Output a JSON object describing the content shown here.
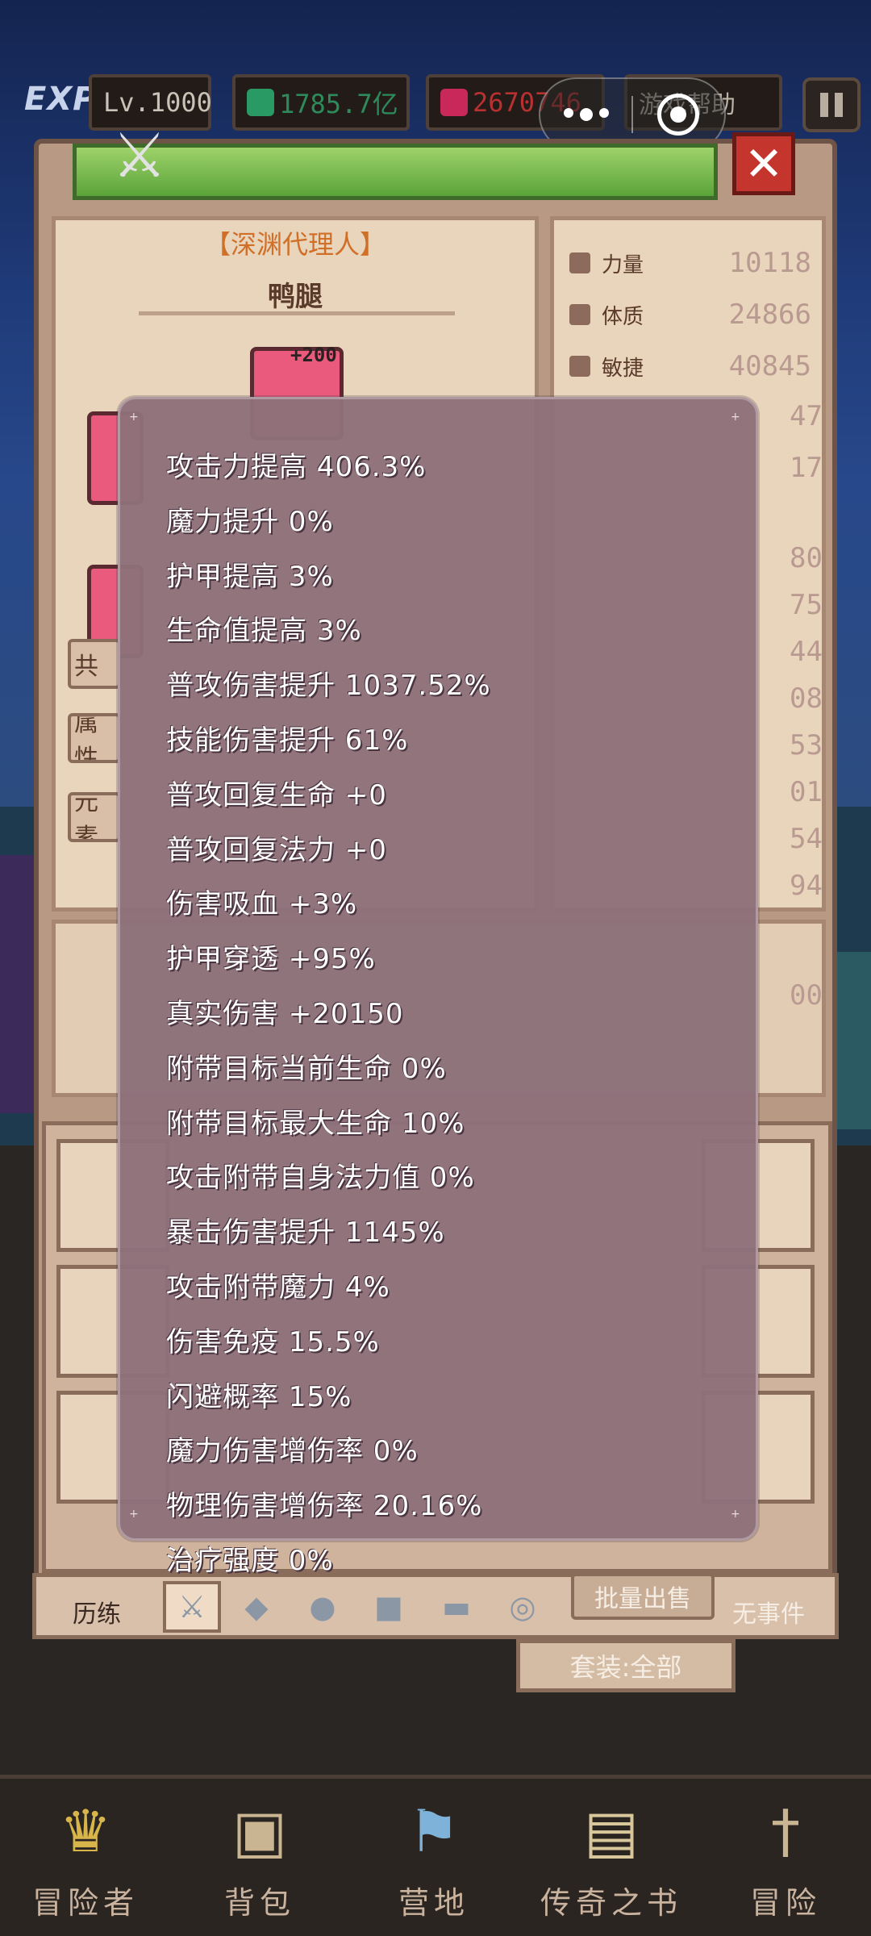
{
  "hud": {
    "exp_label": "EXP",
    "level": "Lv.1000",
    "currency_green": "1785.7亿",
    "currency_red": "2670746",
    "help": "游戏帮助"
  },
  "icons": {
    "close": "close-icon",
    "swords": "crossed-swords-icon",
    "menu_dots": "more-dots-icon",
    "target": "target-icon",
    "pause": "pause-icon"
  },
  "character": {
    "title": "【深渊代理人】",
    "name": "鸭腿",
    "slot_badge": "+200"
  },
  "stats": [
    {
      "label": "力量",
      "value": "10118"
    },
    {
      "label": "体质",
      "value": "24866"
    },
    {
      "label": "敏捷",
      "value": "40845"
    }
  ],
  "partial_values": [
    "47",
    "17",
    "80",
    "75",
    "44",
    "08",
    "53",
    "01",
    "54",
    "94",
    "00"
  ],
  "side_tabs": [
    "共",
    "属性",
    "元素"
  ],
  "tooltip": {
    "lines": [
      "攻击力提高 406.3%",
      "魔力提升 0%",
      "护甲提高 3%",
      "生命值提高 3%",
      "普攻伤害提升 1037.52%",
      "技能伤害提升 61%",
      "普攻回复生命 +0",
      "普攻回复法力 +0",
      "伤害吸血 +3%",
      "护甲穿透 +95%",
      "真实伤害 +20150",
      "附带目标当前生命 0%",
      "附带目标最大生命 10%",
      "攻击附带自身法力值 0%",
      "暴击伤害提升 1145%",
      "攻击附带魔力 4%",
      "伤害免疫 15.5%",
      "闪避概率 15%",
      "魔力伤害增伤率 0%",
      "物理伤害增伤率 20.16%",
      "治疗强度 0%"
    ]
  },
  "toolbar": {
    "lilian": "历练",
    "batch_sell": "批量出售",
    "no_event": "无事件",
    "set_filter": "套装:全部"
  },
  "nav": {
    "items": [
      {
        "label": "冒险者",
        "icon": "crown-icon"
      },
      {
        "label": "背包",
        "icon": "backpack-icon"
      },
      {
        "label": "营地",
        "icon": "camp-banner-icon"
      },
      {
        "label": "传奇之书",
        "icon": "book-icon"
      },
      {
        "label": "冒险",
        "icon": "sword-icon"
      }
    ]
  },
  "colors": {
    "tooltip_bg": "#8d717a",
    "panel_bg": "#e9d4bc",
    "title_orange": "#d07028",
    "close_red": "#c4352e"
  }
}
